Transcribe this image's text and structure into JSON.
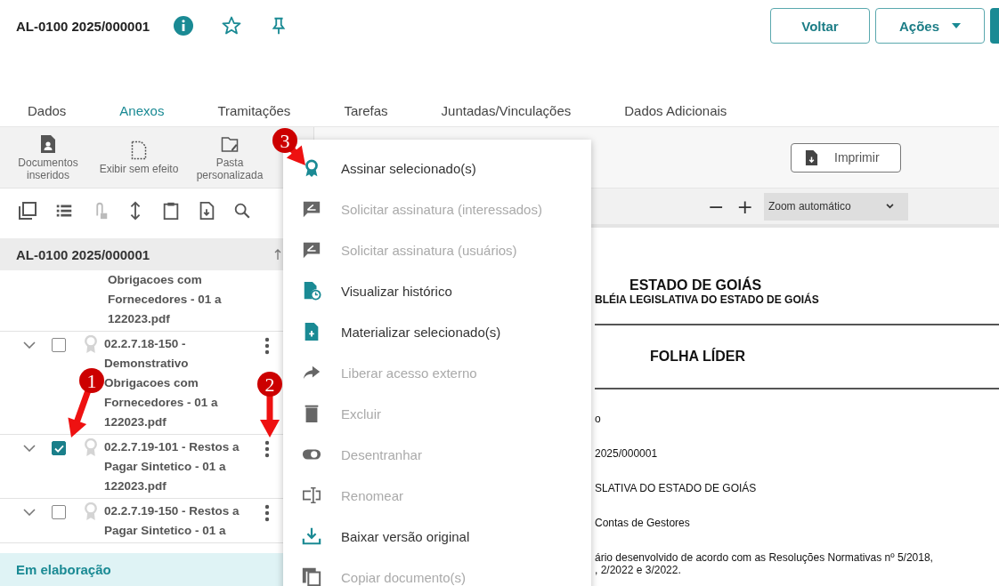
{
  "header": {
    "title": "AL-0100 2025/000001",
    "buttons": [
      {
        "label": "Voltar",
        "kind": "plain"
      },
      {
        "label": "Ações",
        "kind": "dropdown"
      }
    ]
  },
  "tabs": [
    {
      "label": "Dados",
      "selected": false
    },
    {
      "label": "Anexos",
      "selected": true
    },
    {
      "label": "Tramitações",
      "selected": false
    },
    {
      "label": "Tarefas",
      "selected": false
    },
    {
      "label": "Juntadas/Vinculações",
      "selected": false
    },
    {
      "label": "Dados Adicionais",
      "selected": false
    }
  ],
  "left_panel": {
    "toolbar": [
      {
        "label": "Documentos inseridos",
        "kind": "person-doc"
      },
      {
        "label": "Exibir sem efeito",
        "kind": "dashed-doc"
      },
      {
        "label": "Pasta personalizada",
        "kind": "folder"
      }
    ],
    "group_title": "AL-0100 2025/000001",
    "documents": [
      {
        "kind": "continuation",
        "name": "Obrigacoes com Fornecedores - 01 a 122023.pdf"
      },
      {
        "kind": "item",
        "name": "02.2.7.18-150 - Demonstrativo Obrigacoes com Fornecedores - 01 a 122023.pdf",
        "checked": false
      },
      {
        "kind": "item",
        "name": "02.2.7.19-101 - Restos a Pagar Sintetico - 01 a 122023.pdf",
        "checked": true
      },
      {
        "kind": "item",
        "name": "02.2.7.19-150 - Restos a Pagar Sintetico - 01 a",
        "checked": false
      }
    ],
    "status": "Em elaboração"
  },
  "viewer": {
    "print_button": "Imprimir",
    "zoom_out": "−",
    "zoom_in": "+",
    "zoom": "Zoom automático",
    "document": {
      "state": "ESTADO DE GOIÁS",
      "assembly": "BLÉIA LEGISLATIVA DO ESTADO DE GOIÁS",
      "sheet_title": "FOLHA LÍDER",
      "lines": [
        "o",
        "2025/000001",
        "SLATIVA DO ESTADO DE GOIÁS",
        "Contas de Gestores",
        "ário desenvolvido de acordo com as Resoluções Normativas nº 5/2018,\n, 2/2022 e 3/2022."
      ]
    }
  },
  "context_menu": [
    {
      "label": "Assinar selecionado(s)",
      "kind": "seal",
      "disabled": false
    },
    {
      "label": "Solicitar assinatura (interessados)",
      "kind": "request",
      "disabled": true
    },
    {
      "label": "Solicitar assinatura (usuários)",
      "kind": "request",
      "disabled": true
    },
    {
      "label": "Visualizar histórico",
      "kind": "history",
      "disabled": false
    },
    {
      "label": "Materializar selecionado(s)",
      "kind": "materialize",
      "disabled": false
    },
    {
      "label": "Liberar acesso externo",
      "kind": "share",
      "disabled": true
    },
    {
      "label": "Excluir",
      "kind": "trash",
      "disabled": true
    },
    {
      "label": "Desentranhar",
      "kind": "toggle",
      "disabled": true
    },
    {
      "label": "Renomear",
      "kind": "rename",
      "disabled": true
    },
    {
      "label": "Baixar versão original",
      "kind": "download",
      "disabled": false
    },
    {
      "label": "Copiar documento(s)",
      "kind": "copy",
      "disabled": true
    }
  ],
  "annotations": [
    {
      "number": "1"
    },
    {
      "number": "2"
    },
    {
      "number": "3"
    }
  ]
}
